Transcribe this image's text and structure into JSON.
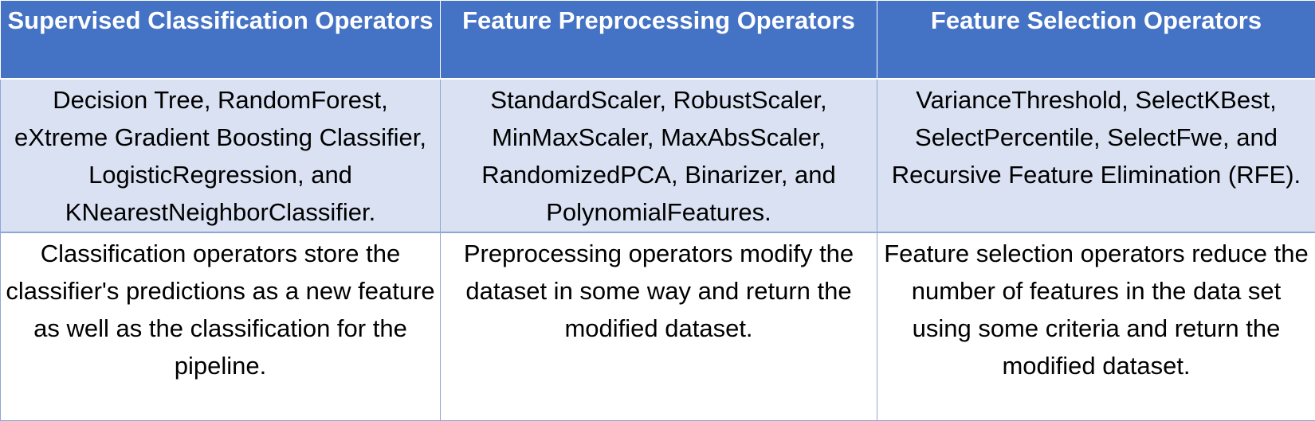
{
  "columns": [
    {
      "header": "Supervised Classification Operators",
      "operators": "Decision Tree, RandomForest, eXtreme Gradient Boosting Classifier, LogisticRegression, and KNearestNeighborClassifier.",
      "description": "Classification operators store the classifier's predictions as a new feature as well as the classification for the pipeline."
    },
    {
      "header": "Feature Preprocessing Operators",
      "operators": "StandardScaler, RobustScaler, MinMaxScaler, MaxAbsScaler, RandomizedPCA, Binarizer, and PolynomialFeatures.",
      "description": "Preprocessing operators modify the dataset in some way and return the modified dataset."
    },
    {
      "header": "Feature Selection Operators",
      "operators": "VarianceThreshold, SelectKBest, SelectPercentile, SelectFwe, and Recursive Feature Elimination (RFE).",
      "description": "Feature selection operators reduce the number of features in the data set using some criteria and return the modified dataset."
    }
  ],
  "colors": {
    "header_bg": "#4472c4",
    "header_text": "#ffffff",
    "band_bg": "#d9e1f2",
    "body_bg": "#ffffff",
    "border": "#8fa6d6"
  }
}
